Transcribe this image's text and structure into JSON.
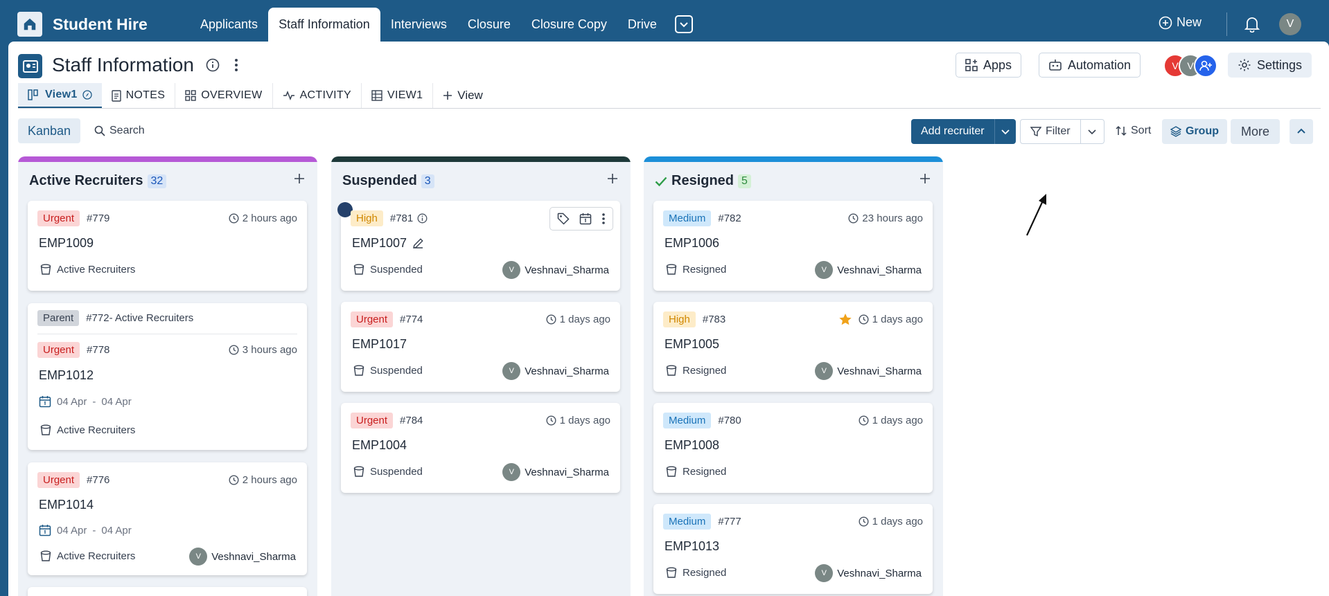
{
  "app": {
    "title": "Student Hire"
  },
  "nav": {
    "tabs": [
      "Applicants",
      "Staff Information",
      "Interviews",
      "Closure",
      "Closure Copy",
      "Drive"
    ],
    "active": 1,
    "new_label": "New",
    "user_initial": "V"
  },
  "page": {
    "title": "Staff Information",
    "buttons": {
      "apps": "Apps",
      "automation": "Automation",
      "settings": "Settings"
    },
    "members": [
      {
        "initial": "V",
        "color": "#e53935"
      },
      {
        "initial": "V",
        "color": "#7a8785"
      },
      {
        "initial": "",
        "color": "#2563eb"
      }
    ]
  },
  "views": {
    "tabs": [
      "View1",
      "NOTES",
      "OVERVIEW",
      "ACTIVITY",
      "VIEW1"
    ],
    "add_view": "View"
  },
  "toolbar": {
    "layout": "Kanban",
    "search": "Search",
    "add_recruiter": "Add recruiter",
    "filter": "Filter",
    "sort": "Sort",
    "group": "Group",
    "more": "More"
  },
  "columns": [
    {
      "name": "Active Recruiters",
      "count": "32",
      "color": "#b659d6",
      "count_bg": "#d6e4f7",
      "count_color": "#1a56b8",
      "cards": [
        {
          "priority": "Urgent",
          "id": "#779",
          "time": "2 hours ago",
          "emp": "EMP1009",
          "status": "Active Recruiters"
        },
        {
          "parent": "Parent",
          "parent_ref": "#772- Active Recruiters",
          "priority": "Urgent",
          "id": "#778",
          "time": "3 hours ago",
          "emp": "EMP1012",
          "date_from": "04 Apr",
          "date_sep": "-",
          "date_to": "04 Apr",
          "status": "Active Recruiters"
        },
        {
          "priority": "Urgent",
          "id": "#776",
          "time": "2 hours ago",
          "emp": "EMP1014",
          "date_from": "04 Apr",
          "date_sep": "-",
          "date_to": "04 Apr",
          "status": "Active Recruiters",
          "owner": "Veshnavi_Sharma",
          "owner_initial": "V"
        }
      ]
    },
    {
      "name": "Suspended",
      "count": "3",
      "color": "#1e3a3a",
      "count_bg": "#d6e4f7",
      "count_color": "#1a56b8",
      "cards": [
        {
          "priority": "High",
          "id": "#781",
          "emp": "EMP1007",
          "status": "Suspended",
          "owner": "Veshnavi_Sharma",
          "owner_initial": "V"
        },
        {
          "priority": "Urgent",
          "id": "#774",
          "time": "1 days ago",
          "emp": "EMP1017",
          "status": "Suspended",
          "owner": "Veshnavi_Sharma",
          "owner_initial": "V"
        },
        {
          "priority": "Urgent",
          "id": "#784",
          "time": "1 days ago",
          "emp": "EMP1004",
          "status": "Suspended",
          "owner": "Veshnavi_Sharma",
          "owner_initial": "V"
        }
      ]
    },
    {
      "name": "Resigned",
      "count": "5",
      "color": "#1c8fd8",
      "count_bg": "#d4f0d6",
      "count_color": "#2e8b3d",
      "cards": [
        {
          "priority": "Medium",
          "id": "#782",
          "time": "23 hours ago",
          "emp": "EMP1006",
          "status": "Resigned",
          "owner": "Veshnavi_Sharma",
          "owner_initial": "V"
        },
        {
          "priority": "High",
          "id": "#783",
          "time": "1 days ago",
          "emp": "EMP1005",
          "status": "Resigned",
          "owner": "Veshnavi_Sharma",
          "owner_initial": "V"
        },
        {
          "priority": "Medium",
          "id": "#780",
          "time": "1 days ago",
          "emp": "EMP1008",
          "status": "Resigned"
        },
        {
          "priority": "Medium",
          "id": "#777",
          "time": "1 days ago",
          "emp": "EMP1013",
          "status": "Resigned",
          "owner": "Veshnavi_Sharma",
          "owner_initial": "V"
        }
      ]
    }
  ]
}
